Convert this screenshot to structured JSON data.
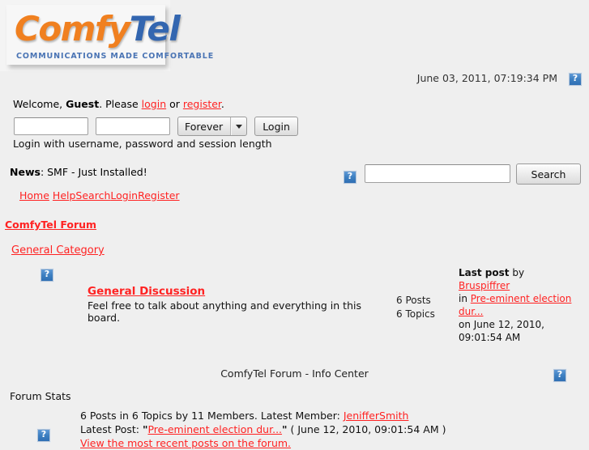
{
  "logo": {
    "part1": "Comfy",
    "part2": "Tel",
    "tagline": "COMMUNICATIONS MADE COMFORTABLE",
    "color_primary": "#f08020",
    "color_secondary": "#3366b0",
    "tagline_color": "#4a74b4"
  },
  "header": {
    "datetime": "June 03, 2011, 07:19:34 PM",
    "broken_image_icon": "broken-image-icon"
  },
  "login": {
    "welcome_prefix": "Welcome, ",
    "guest_label": "Guest",
    "please_text": ". Please ",
    "login_link": "login",
    "or_text": " or ",
    "register_link": "register",
    "period": ".",
    "username_value": "",
    "username_placeholder": "",
    "password_value": "",
    "password_placeholder": "",
    "session_length_selected": "Forever",
    "session_length_options": [
      "Forever"
    ],
    "login_button": "Login",
    "hint": "Login with username, password and session length"
  },
  "news": {
    "label": "News",
    "separator": ": ",
    "text": "SMF - Just Installed!"
  },
  "search": {
    "value": "",
    "placeholder": "",
    "button_label": "Search"
  },
  "nav": {
    "items": [
      "Home",
      "Help",
      "Search",
      "Login",
      "Register"
    ]
  },
  "breadcrumb": {
    "text": "ComfyTel Forum"
  },
  "category": {
    "title": "General Category"
  },
  "board": {
    "name": "General Discussion",
    "description": "Feel free to talk about anything and everything in this board.",
    "posts": "6 Posts",
    "topics": "6 Topics",
    "lastpost_label": "Last post",
    "by_text": " by",
    "author": "Bruspiffrer",
    "in_text": "in ",
    "topic": "Pre-eminent election dur...",
    "on_text": "on June 12, 2010,",
    "time_text": "09:01:54 AM"
  },
  "infocenter": {
    "title": "ComfyTel Forum - Info Center",
    "stats_heading": "Forum Stats",
    "stats_line_prefix": "6 Posts in 6 Topics by 11 Members. Latest Member: ",
    "latest_member": "JenifferSmith",
    "latest_post_label": "Latest Post: ",
    "latest_post_quote_open": "\"",
    "latest_post_title": "Pre-eminent election dur...",
    "latest_post_quote_close": "\"",
    "latest_post_date": " ( June 12, 2010, 09:01:54 AM )",
    "recent_posts_link": "View the most recent posts on the forum."
  },
  "colors": {
    "page_background": "#efefef",
    "link": "#ff2222",
    "text": "#000000"
  }
}
